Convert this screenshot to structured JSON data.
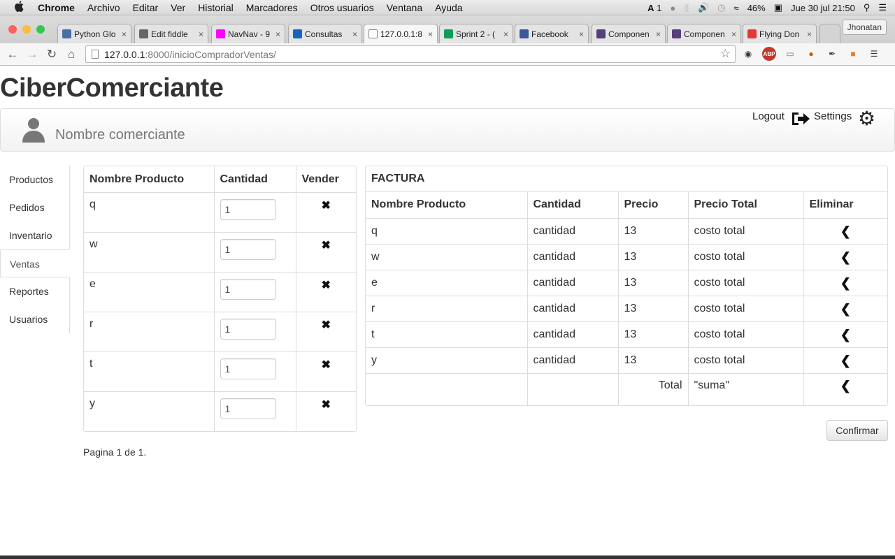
{
  "menubar": {
    "app": "Chrome",
    "items": [
      "Archivo",
      "Editar",
      "Ver",
      "Historial",
      "Marcadores",
      "Otros usuarios",
      "Ventana",
      "Ayuda"
    ],
    "status": {
      "adobe_count": "1",
      "battery": "46%",
      "datetime": "Jue 30 jul  21:50"
    }
  },
  "browser": {
    "tabs": [
      {
        "title": "Python Glo",
        "color": "#4a6fa5"
      },
      {
        "title": "Edit fiddle",
        "color": "#666666"
      },
      {
        "title": "NavNav - 9",
        "color": "#ff00ff"
      },
      {
        "title": "Consultas",
        "color": "#1565c0"
      },
      {
        "title": "127.0.0.1:8",
        "color": "#ffffff"
      },
      {
        "title": "Sprint 2 - (",
        "color": "#0f9d58"
      },
      {
        "title": "Facebook",
        "color": "#3b5998"
      },
      {
        "title": "Componen",
        "color": "#563d7c"
      },
      {
        "title": "Componen",
        "color": "#563d7c"
      },
      {
        "title": "Flying Don",
        "color": "#e53935"
      }
    ],
    "active_tab": 4,
    "profile": "Jhonatan",
    "url_host": "127.0.0.1",
    "url_path": ":8000/inicioCompradorVentas/"
  },
  "page": {
    "brand": "CiberComerciante",
    "merchant_name": "Nombre comerciante",
    "logout_label": "Logout",
    "settings_label": "Settings",
    "sidebar": [
      "Productos",
      "Pedidos",
      "Inventario",
      "Ventas",
      "Reportes",
      "Usuarios"
    ],
    "sidebar_active": "Ventas",
    "products_table": {
      "headers": [
        "Nombre Producto",
        "Cantidad",
        "Vender"
      ],
      "rows": [
        {
          "name": "q",
          "qty": "1"
        },
        {
          "name": "w",
          "qty": "1"
        },
        {
          "name": "e",
          "qty": "1"
        },
        {
          "name": "r",
          "qty": "1"
        },
        {
          "name": "t",
          "qty": "1"
        },
        {
          "name": "y",
          "qty": "1"
        }
      ]
    },
    "invoice": {
      "caption": "FACTURA",
      "headers": [
        "Nombre Producto",
        "Cantidad",
        "Precio",
        "Precio Total",
        "Eliminar"
      ],
      "rows": [
        {
          "name": "q",
          "qty": "cantidad",
          "price": "13",
          "total": "costo total"
        },
        {
          "name": "w",
          "qty": "cantidad",
          "price": "13",
          "total": "costo total"
        },
        {
          "name": "e",
          "qty": "cantidad",
          "price": "13",
          "total": "costo total"
        },
        {
          "name": "r",
          "qty": "cantidad",
          "price": "13",
          "total": "costo total"
        },
        {
          "name": "t",
          "qty": "cantidad",
          "price": "13",
          "total": "costo total"
        },
        {
          "name": "y",
          "qty": "cantidad",
          "price": "13",
          "total": "costo total"
        }
      ],
      "total_label": "Total",
      "total_value": "\"suma\""
    },
    "confirm_label": "Confirmar",
    "pagination": "Pagina 1 de 1."
  }
}
